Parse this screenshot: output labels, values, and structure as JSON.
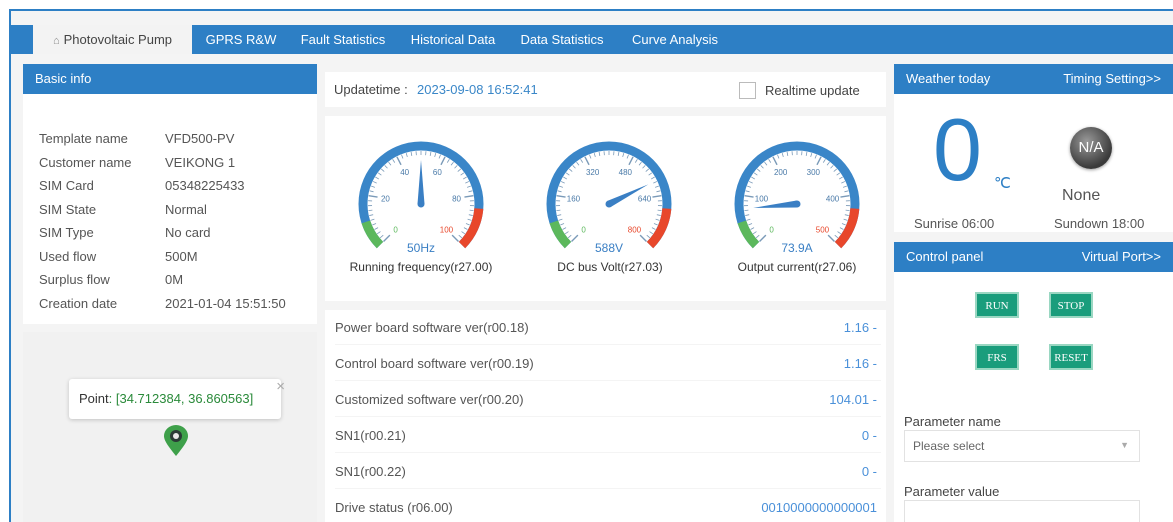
{
  "tabs": [
    {
      "label": "Photovoltaic Pump",
      "icon": "home-icon",
      "active": true
    },
    {
      "label": "GPRS R&W"
    },
    {
      "label": "Fault Statistics"
    },
    {
      "label": "Historical Data"
    },
    {
      "label": "Data Statistics"
    },
    {
      "label": "Curve Analysis"
    }
  ],
  "basic": {
    "title": "Basic info",
    "rows": [
      {
        "k": "Template name",
        "v": "VFD500-PV"
      },
      {
        "k": "Customer name",
        "v": "VEIKONG 1"
      },
      {
        "k": "SIM Card",
        "v": "05348225433"
      },
      {
        "k": "SIM State",
        "v": "Normal"
      },
      {
        "k": "SIM Type",
        "v": "No card"
      },
      {
        "k": "Used flow",
        "v": "500M"
      },
      {
        "k": "Surplus flow",
        "v": "0M"
      },
      {
        "k": "Creation date",
        "v": "2021-01-04 15:51:50"
      }
    ]
  },
  "map": {
    "point_label": "Point",
    "point_value": ": [34.712384, 36.860563]",
    "close": "×"
  },
  "update": {
    "label": "Updatetime : ",
    "time": "2023-09-08 16:52:41",
    "realtime": "Realtime update"
  },
  "gauges": [
    {
      "caption": "Running frequency(r27.00)",
      "reading": "50Hz",
      "min": 0,
      "max": 100,
      "value": 50,
      "ticks": [
        "0",
        "20",
        "40",
        "60",
        "80",
        "100"
      ]
    },
    {
      "caption": "DC bus Volt(r27.03)",
      "reading": "588V",
      "min": 0,
      "max": 800,
      "value": 588,
      "ticks": [
        "0",
        "160",
        "320",
        "480",
        "640",
        "800"
      ]
    },
    {
      "caption": "Output current(r27.06)",
      "reading": "73.9A",
      "min": 0,
      "max": 500,
      "value": 73.9,
      "ticks": [
        "0",
        "100",
        "200",
        "300",
        "400",
        "500"
      ]
    }
  ],
  "params": [
    {
      "k": "Power board software ver(r00.18)",
      "v": "1.16 -"
    },
    {
      "k": "Control board software ver(r00.19)",
      "v": "1.16 -"
    },
    {
      "k": "Customized software ver(r00.20)",
      "v": "104.01 -"
    },
    {
      "k": "SN1(r00.21)",
      "v": "0 -"
    },
    {
      "k": "SN1(r00.22)",
      "v": "0 -"
    },
    {
      "k": "Drive status (r06.00)",
      "v": "0010000000000001"
    }
  ],
  "weather": {
    "title": "Weather today",
    "link": "Timing Setting>>",
    "temp": "0",
    "unit": "℃",
    "icon_text": "N/A",
    "condition": "None",
    "sunrise": "Sunrise 06:00",
    "sundown": "Sundown 18:00"
  },
  "control": {
    "title": "Control panel",
    "link": "Virtual Port>>",
    "run": "RUN",
    "stop": "STOP",
    "frs": "FRS",
    "reset": "RESET",
    "param_name_label": "Parameter name",
    "param_name_placeholder": "Please select",
    "param_value_label": "Parameter value"
  },
  "colors": {
    "accent": "#2d7fc5",
    "gauge_green": "#5cb85c",
    "gauge_red": "#e8472b",
    "button": "#1a9d7c"
  }
}
